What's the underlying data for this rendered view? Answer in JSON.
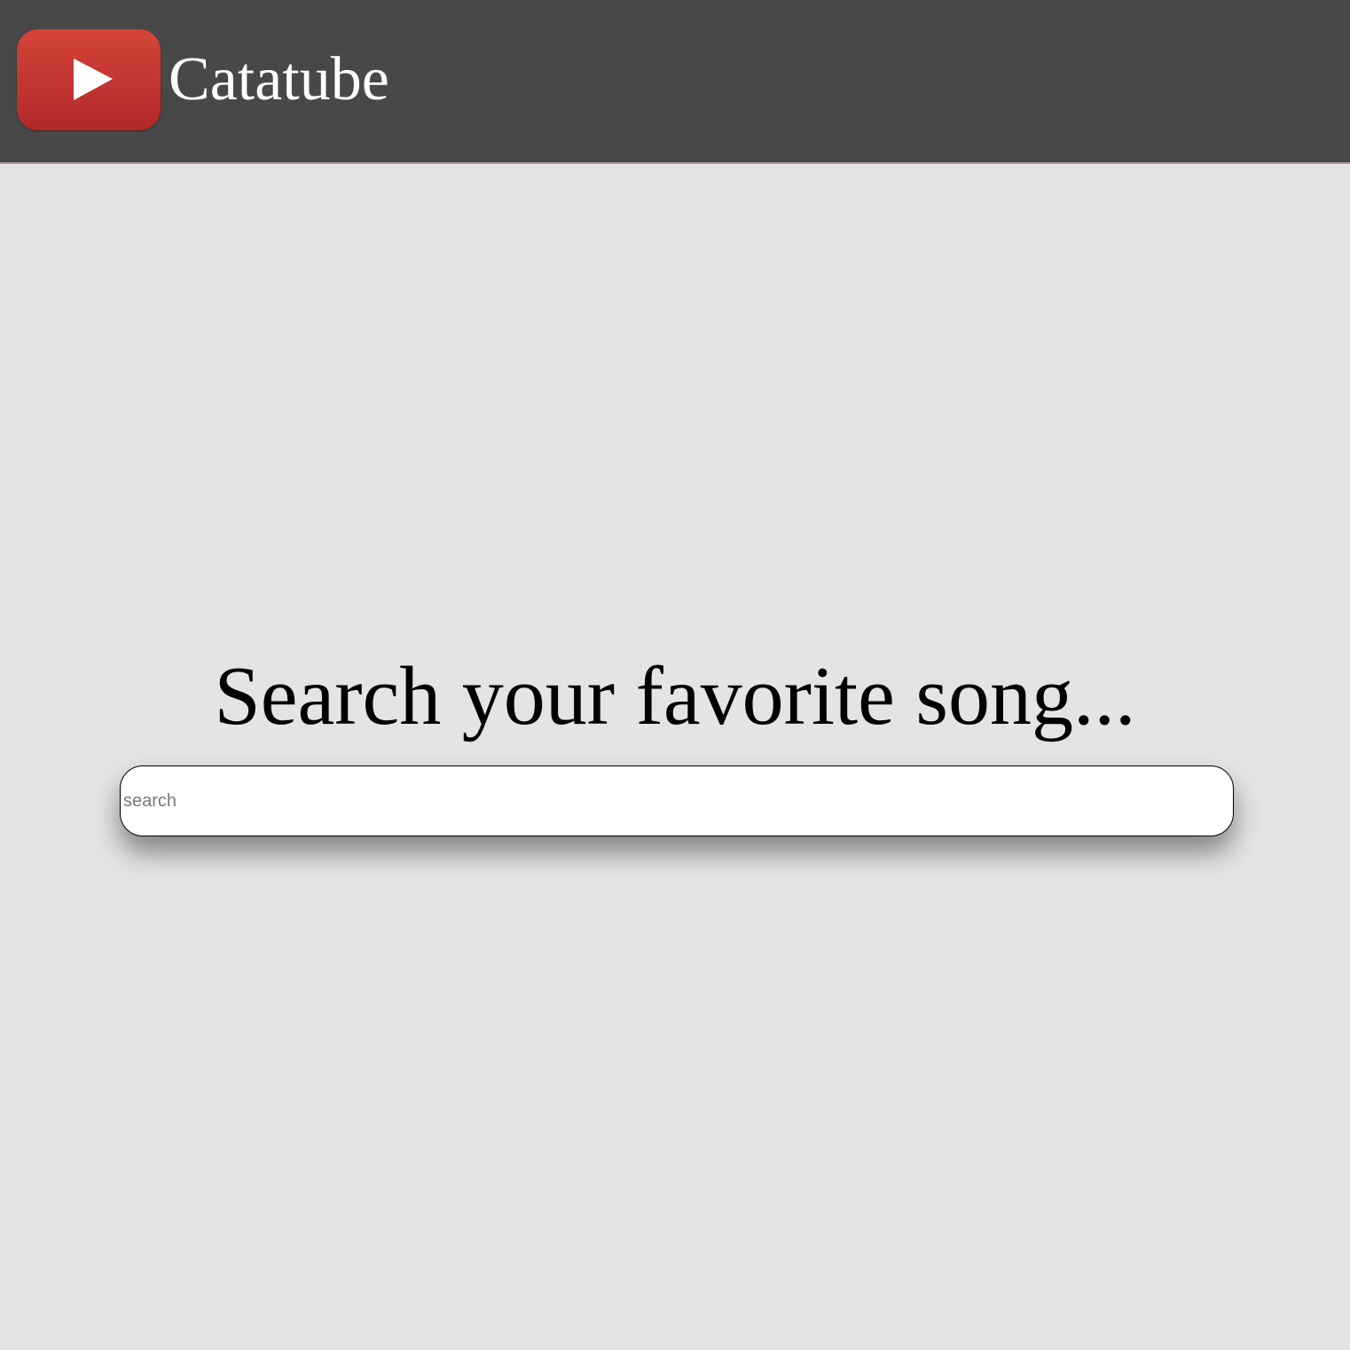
{
  "header": {
    "brand": "Catatube",
    "logo_icon": "play-icon",
    "background_color": "#484848",
    "logo_color": "#c7352f"
  },
  "main": {
    "heading": "Search your favorite song...",
    "search": {
      "placeholder": "search",
      "value": ""
    },
    "background_color": "#e5e3e4"
  }
}
